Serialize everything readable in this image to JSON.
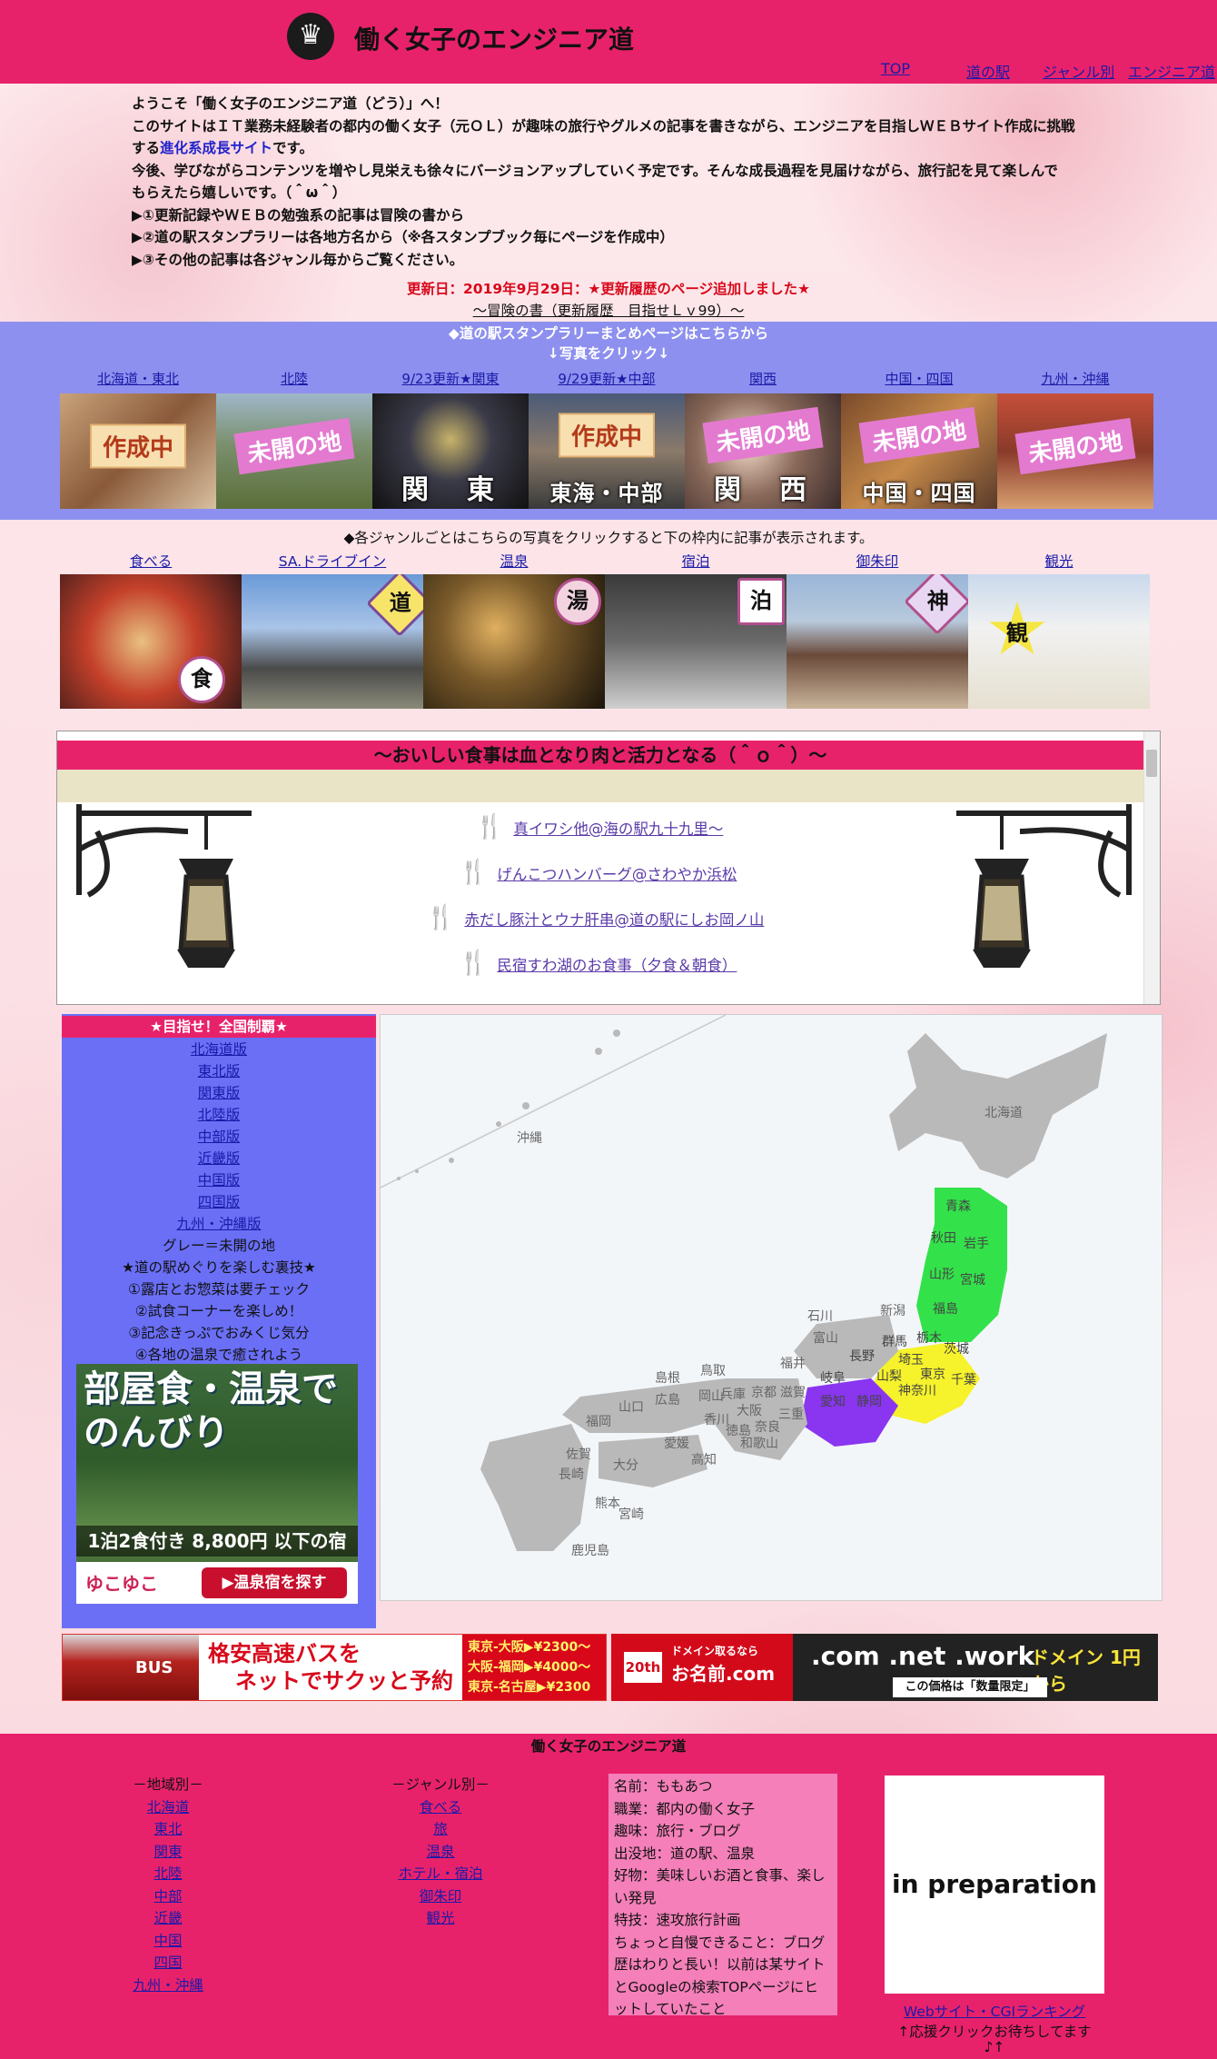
{
  "header": {
    "site_title": "働く女子のエンジニア道",
    "nav": [
      "TOP",
      "道の駅",
      "ジャンル別",
      "エンジニア道"
    ]
  },
  "intro": {
    "lines": [
      "ようこそ「働く女子のエンジニア道（どう）」へ！",
      "このサイトはＩＴ業務未経験者の都内の働く女子（元ＯＬ）が趣味の旅行やグルメの記事を書きながら、エンジニアを目指しＷＥＢサイト作成に挑戦",
      "する",
      "進化系成長サイト",
      "です。",
      "今後、学びながらコンテンツを増やし見栄えも徐々にバージョンアップしていく予定です。そんな成長過程を見届けながら、旅行記を見て楽しんで",
      "もらえたら嬉しいです。（＾ω＾）",
      "▶①更新記録やＷＥＢの勉強系の記事は冒険の書から",
      "▶②道の駅スタンプラリーは各地方名から（※各スタンプブック毎にページを作成中）",
      "▶③その他の記事は各ジャンル毎からご覧ください。"
    ],
    "update_text": "更新日：2019年9月29日：★更新履歴のページ追加しました★",
    "update_link": "～冒険の書（更新履歴　目指せＬｖ99）～"
  },
  "stamp": {
    "note_line1": "◆道の駅スタンプラリーまとめページはこちらから",
    "note_line2": "↓写真をクリック↓",
    "regions": [
      {
        "label": "北海道・東北",
        "badge": "作成中",
        "caption": ""
      },
      {
        "label": "北陸",
        "badge": "未開の地",
        "caption": ""
      },
      {
        "label": "9/23更新★関東",
        "badge": "",
        "caption": "関　東"
      },
      {
        "label": "9/29更新★中部",
        "badge": "作成中",
        "caption": "東海・中部"
      },
      {
        "label": "関西",
        "badge": "未開の地",
        "caption": "関　西"
      },
      {
        "label": "中国・四国",
        "badge": "未開の地",
        "caption": "中国・四国"
      },
      {
        "label": "九州・沖縄",
        "badge": "未開の地",
        "caption": ""
      }
    ]
  },
  "genre": {
    "note": "◆各ジャンルごとはこちらの写真をクリックすると下の枠内に記事が表示されます。",
    "items": [
      {
        "label": "食べる",
        "badge": "食"
      },
      {
        "label": "SA.ドライブイン",
        "badge": "道"
      },
      {
        "label": "温泉",
        "badge": "湯"
      },
      {
        "label": "宿泊",
        "badge": "泊"
      },
      {
        "label": "御朱印",
        "badge": "神"
      },
      {
        "label": "観光",
        "badge": "観"
      }
    ]
  },
  "frame": {
    "title": "～おいしい食事は血となり肉と活力となる（＾ｏ＾）～",
    "articles": [
      "真イワシ他@海の駅九十九里～",
      "げんこつハンバーグ@さわやか浜松",
      "赤だし豚汁とウナ肝串@道の駅にしお岡ノ山",
      "民宿すわ湖のお食事（夕食＆朝食）"
    ]
  },
  "sidebar": {
    "header": "★目指せ！全国制覇★",
    "links": [
      "北海道版",
      "東北版",
      "関東版",
      "北陸版",
      "中部版",
      "近畿版",
      "中国版",
      "四国版",
      "九州・沖縄版"
    ],
    "texts": [
      "グレー＝未開の地",
      "★道の駅めぐりを楽しむ裏技★",
      "①露店とお惣菜は要チェック",
      "②試食コーナーを楽しめ！",
      "③記念きっぷでおみくじ気分",
      "④各地の温泉で癒されよう"
    ],
    "ad": {
      "title_line1": "部屋食・温泉で",
      "title_line2": "のんびり",
      "price": "1泊2食付き 8,800円 以下の宿",
      "brand": "ゆこゆこ",
      "button": "▶温泉宿を探す"
    }
  },
  "map": {
    "labels": [
      "北海道",
      "沖縄",
      "青森",
      "秋田",
      "岩手",
      "山形",
      "宮城",
      "新潟",
      "福島",
      "石川",
      "富山",
      "群馬",
      "栃木",
      "茨城",
      "長野",
      "埼玉",
      "福井",
      "岐阜",
      "山梨",
      "東京",
      "千葉",
      "神奈川",
      "静岡",
      "愛知",
      "滋賀",
      "京都",
      "兵庫",
      "大阪",
      "奈良",
      "三重",
      "和歌山",
      "鳥取",
      "島根",
      "岡山",
      "広島",
      "山口",
      "香川",
      "徳島",
      "愛媛",
      "高知",
      "福岡",
      "佐賀",
      "長崎",
      "大分",
      "熊本",
      "宮崎",
      "鹿児島"
    ],
    "colors": {
      "visited_green": "#33e24a",
      "visited_yellow": "#f6f22b",
      "visited_purple": "#8a35f0",
      "unvisited": "#b9b9b9"
    }
  },
  "ads": {
    "bus_text1": "格安高速バスを",
    "bus_text2": "ネットでサクッと予約",
    "bus_routes": [
      "東京-大阪▶¥2300～",
      "大阪-福岡▶¥4000～",
      "東京-名古屋▶¥2300～"
    ],
    "bus_label": "BUS",
    "domain_small": "ドメイン取るなら",
    "domain_brand": "お名前.com",
    "domain_years": "20th",
    "domain_tlds": ".com .net .work",
    "domain_price": "ドメイン 1円 から",
    "domain_note": "この価格は「数量限定」"
  },
  "footer": {
    "title": "働く女子のエンジニア道",
    "region_head": "－地域別－",
    "regions": [
      "北海道",
      "東北",
      "関東",
      "北陸",
      "中部",
      "近畿",
      "中国",
      "四国",
      "九州・沖縄"
    ],
    "genre_head": "－ジャンル別－",
    "genres": [
      "食べる",
      "旅",
      "温泉",
      "ホテル・宿泊",
      "御朱印",
      "観光"
    ],
    "profile": [
      "名前：ももあつ",
      "職業：都内の働く女子",
      "趣味：旅行・ブログ",
      "出没地：道の駅、温泉",
      "好物：美味しいお酒と食事、楽しい発見",
      "特技：速攻旅行計画",
      "ちょっと自慢できること：ブログ歴はわりと長い！以前は某サイトとGoogleの検索TOPページにヒットしていたこと"
    ],
    "prep": "in preparation",
    "rank_link": "Webサイト・CGIランキング",
    "rank_text": "↑応援クリックお待ちしてます",
    "rank_note": "♪↑"
  }
}
